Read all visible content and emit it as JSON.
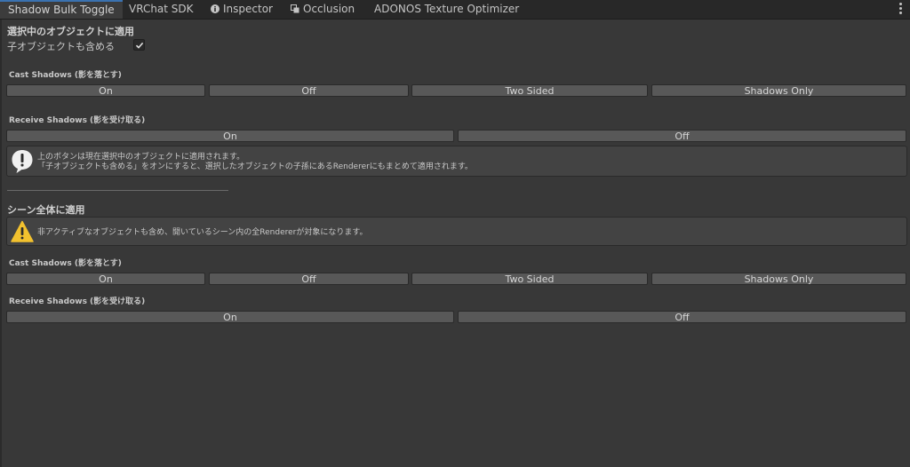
{
  "tabs": [
    {
      "label": "Shadow Bulk Toggle",
      "icon": null
    },
    {
      "label": "VRChat SDK",
      "icon": null
    },
    {
      "label": "Inspector",
      "icon": "info-icon"
    },
    {
      "label": "Occlusion",
      "icon": "occlusion-icon"
    },
    {
      "label": "ADONOS Texture Optimizer",
      "icon": null
    }
  ],
  "selected_section": {
    "title": "選択中のオブジェクトに適用",
    "include_children_label": "子オブジェクトも含める",
    "include_children_checked": true,
    "cast_shadows": {
      "label": "Cast Shadows (影を落とす)",
      "buttons": [
        "On",
        "Off",
        "Two Sided",
        "Shadows Only"
      ]
    },
    "receive_shadows": {
      "label": "Receive Shadows (影を受け取る)",
      "buttons": [
        "On",
        "Off"
      ]
    },
    "info": {
      "line1": "上のボタンは現在選択中のオブジェクトに適用されます。",
      "line2": "「子オブジェクトも含める」をオンにすると、選択したオブジェクトの子孫にあるRendererにもまとめて適用されます。"
    }
  },
  "scene_section": {
    "title": "シーン全体に適用",
    "warning": "非アクティブなオブジェクトも含め、開いているシーン内の全Rendererが対象になります。",
    "cast_shadows": {
      "label": "Cast Shadows (影を落とす)",
      "buttons": [
        "On",
        "Off",
        "Two Sided",
        "Shadows Only"
      ]
    },
    "receive_shadows": {
      "label": "Receive Shadows (影を受け取る)",
      "buttons": [
        "On",
        "Off"
      ]
    }
  },
  "colors": {
    "accent": "#3a72b0",
    "warning": "#f2c12e"
  }
}
